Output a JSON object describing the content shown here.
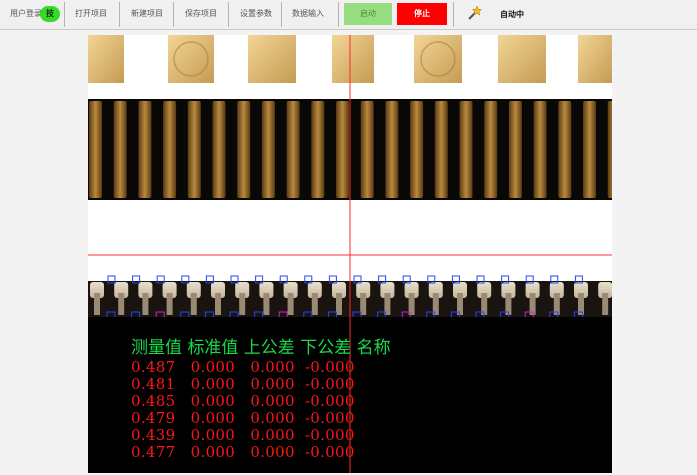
{
  "toolbar": {
    "login_label": "用户登录",
    "tech_badge": "技",
    "open_label": "打开项目",
    "new_label": "新建项目",
    "save_label": "保存项目",
    "params_label": "设置参数",
    "data_input_label": "数据输入",
    "start_label": "启动",
    "stop_label": "停止",
    "status_icon": "magic-wand-icon",
    "status_label": "自动中"
  },
  "results": {
    "header": "测量值 标准值 上公差 下公差 名称",
    "rows": [
      {
        "measured": "0.487",
        "standard": "0.000",
        "upper_tol": "0.000",
        "lower_tol": "-0.000"
      },
      {
        "measured": "0.481",
        "standard": "0.000",
        "upper_tol": "0.000",
        "lower_tol": "-0.000"
      },
      {
        "measured": "0.485",
        "standard": "0.000",
        "upper_tol": "0.000",
        "lower_tol": "-0.000"
      },
      {
        "measured": "0.479",
        "standard": "0.000",
        "upper_tol": "0.000",
        "lower_tol": "-0.000"
      },
      {
        "measured": "0.439",
        "standard": "0.000",
        "upper_tol": "0.000",
        "lower_tol": "-0.000"
      },
      {
        "measured": "0.477",
        "standard": "0.000",
        "upper_tol": "0.000",
        "lower_tol": "-0.000"
      }
    ]
  },
  "colors": {
    "start_bg": "#98dc82",
    "stop_bg": "#ff0000",
    "result_header": "#19d84a",
    "result_values": "#ff1515",
    "crosshair": "#ff0000",
    "roi_box": "#2244ff"
  }
}
